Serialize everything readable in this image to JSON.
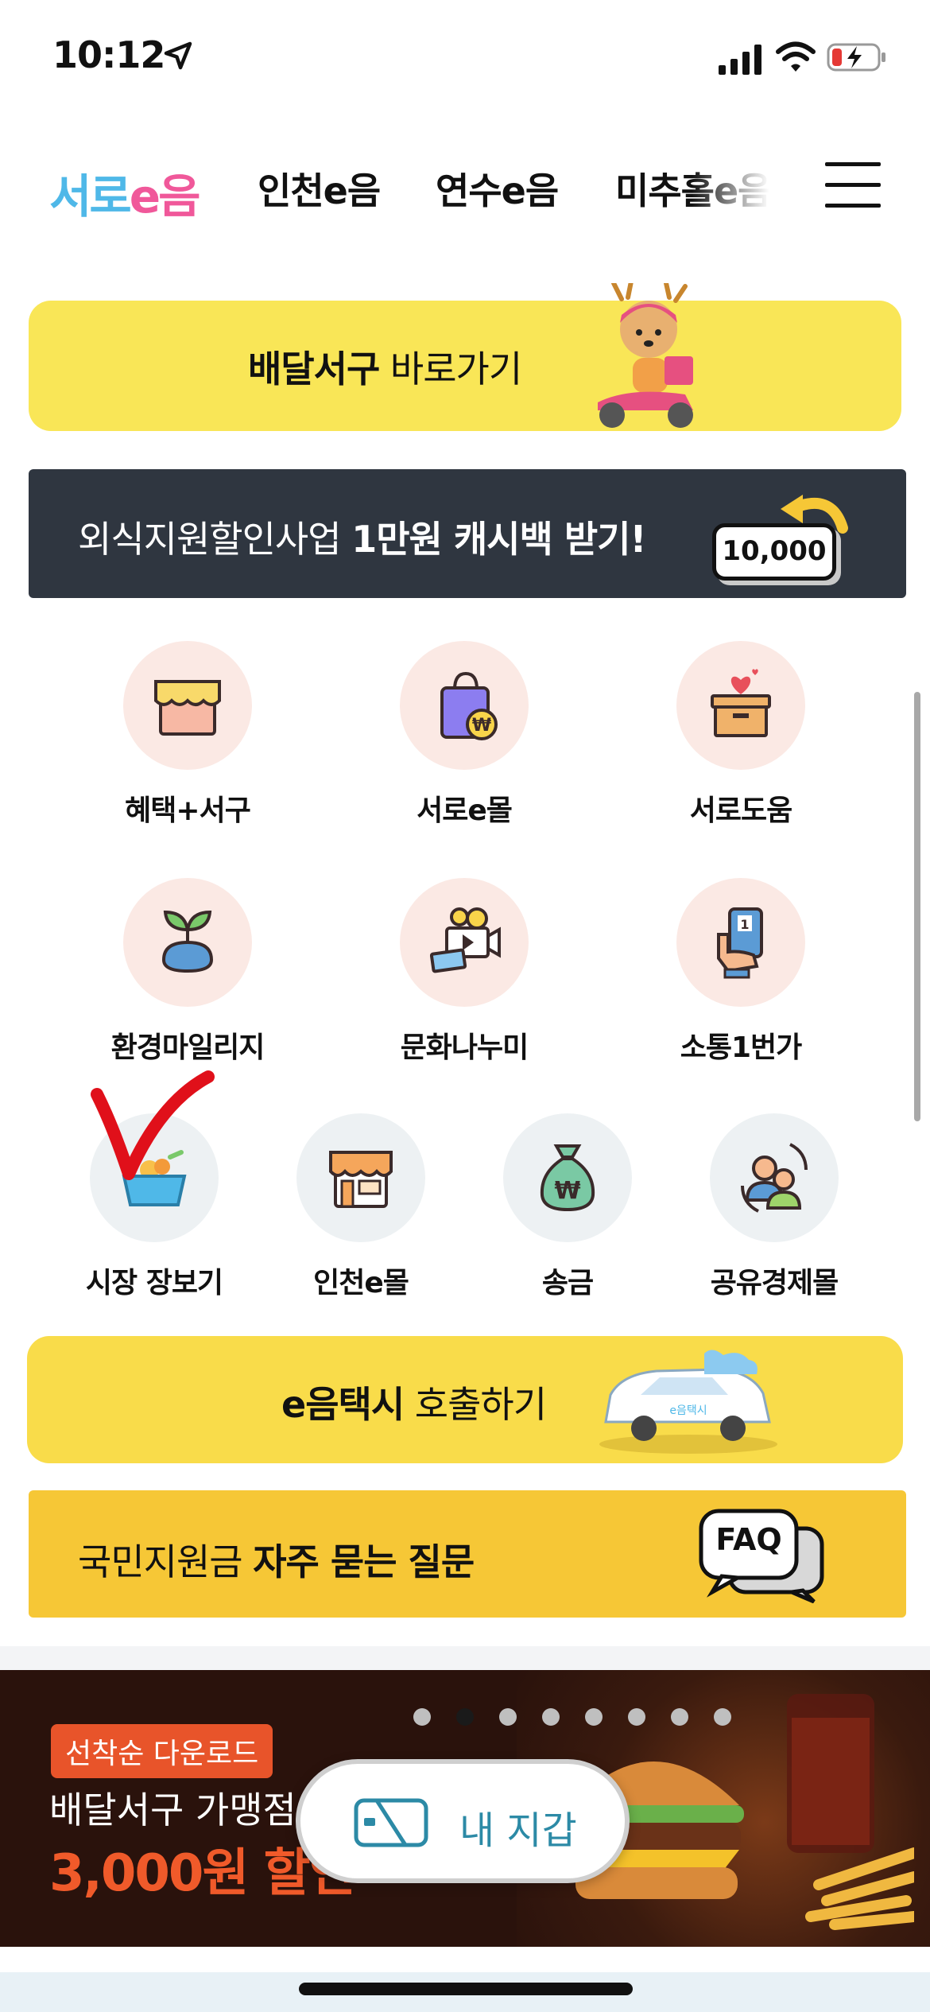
{
  "status": {
    "time": "10:12"
  },
  "nav": {
    "logo_part1": "서로",
    "logo_part2": "e음",
    "items": [
      "인천e음",
      "연수e음",
      "미추홀e음"
    ]
  },
  "banners": {
    "delivery": {
      "bold": "배달서구",
      "rest": " 바로가기"
    },
    "cashback": {
      "rest": "외식지원할인사업 ",
      "bold": "1만원 캐시백 받기!",
      "coin": "10,000"
    },
    "taxi": {
      "bold": "e음택시",
      "rest": " 호출하기",
      "car_text": "e음택시"
    },
    "faq": {
      "rest": "국민지원금 ",
      "bold": "자주 묻는 질문",
      "bubble": "FAQ"
    }
  },
  "grid": {
    "row1": [
      "혜택+서구",
      "서로e몰",
      "서로도움"
    ],
    "row2": [
      "환경마일리지",
      "문화나누미",
      "소통1번가"
    ],
    "row3": [
      "시장 장보기",
      "인천e몰",
      "송금",
      "공유경제몰"
    ]
  },
  "promo": {
    "tag": "선착순 다운로드",
    "line1": "배달서구 가맹점",
    "line2": "3,000원 할인"
  },
  "wallet": {
    "label": "내 지갑"
  },
  "colors": {
    "yellow": "#f9e657",
    "gold": "#f6c736",
    "dark": "#2f3640",
    "logo_blue": "#4fb8e8",
    "logo_pink": "#f0589a",
    "promo_orange": "#f05a2a"
  }
}
